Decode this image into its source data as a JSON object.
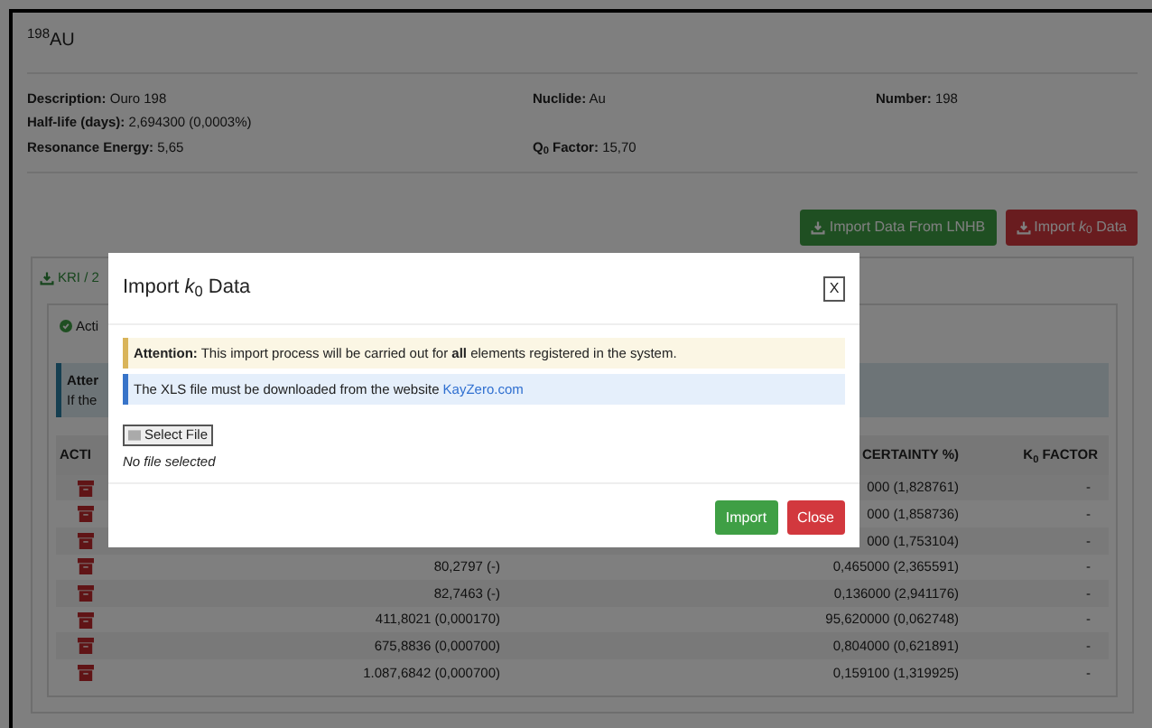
{
  "header": {
    "title": "$^{198}$AU"
  },
  "details": [
    [
      {
        "label": "Description:",
        "value": "Ouro 198"
      },
      {
        "label": "Nuclide:",
        "value": "Au"
      },
      {
        "label": "Number:",
        "value": "198"
      }
    ],
    [
      {
        "label": "Half-life (days):",
        "value": "2,694300 (0,0003%)"
      }
    ],
    [
      {
        "label": "Resonance Energy:",
        "value": "5,65"
      },
      {
        "label": "Q$_{0}$ Factor:",
        "value": "15,70"
      }
    ]
  ],
  "actions": [
    {
      "label": "Import Data From LNHB",
      "kind": "success"
    },
    {
      "label": "Import *k*$_{0}$ Data",
      "kind": "danger"
    }
  ],
  "tab": {
    "label": "KRI / 2",
    "selected": true
  },
  "status": {
    "label": "Acti"
  },
  "alert": {
    "title": "Atter",
    "text": "If the"
  },
  "table": {
    "columns": [
      "ACTI",
      "CERTAINTY %)",
      "K$_{0}$ FACTOR"
    ],
    "rows": [
      {
        "column_2": "",
        "column_3": "000 (1,828761)",
        "k0": "-"
      },
      {
        "column_2": "",
        "column_3": "000 (1,858736)",
        "k0": "-"
      },
      {
        "column_2": "",
        "column_3": "000 (1,753104)",
        "k0": "-"
      },
      {
        "column_2": "80,2797 (-)",
        "column_3": "0,465000 (2,365591)",
        "k0": "-"
      },
      {
        "column_2": "82,7463 (-)",
        "column_3": "0,136000 (2,941176)",
        "k0": "-"
      },
      {
        "column_2": "411,8021 (0,000170)",
        "column_3": "95,620000 (0,062748)",
        "k0": "-"
      },
      {
        "column_2": "675,8836 (0,000700)",
        "column_3": "0,804000 (0,621891)",
        "k0": "-"
      },
      {
        "column_2": "1.087,6842 (0,000700)",
        "column_3": "0,159100 (1,319925)",
        "k0": "-"
      }
    ]
  },
  "modal": {
    "title": "Import *k*$_{0}$ Data",
    "close": "X",
    "warning": "**Attention:** This import process will be carried out for **all** elements registered in the system.",
    "info_text": "The XLS file must be downloaded from the website",
    "info_link": "KayZero.com",
    "file_button": "Select File",
    "file_status": "No file selected",
    "buttons": [
      {
        "label": "Import",
        "kind": "success"
      },
      {
        "label": "Close",
        "kind": "danger"
      }
    ]
  }
}
